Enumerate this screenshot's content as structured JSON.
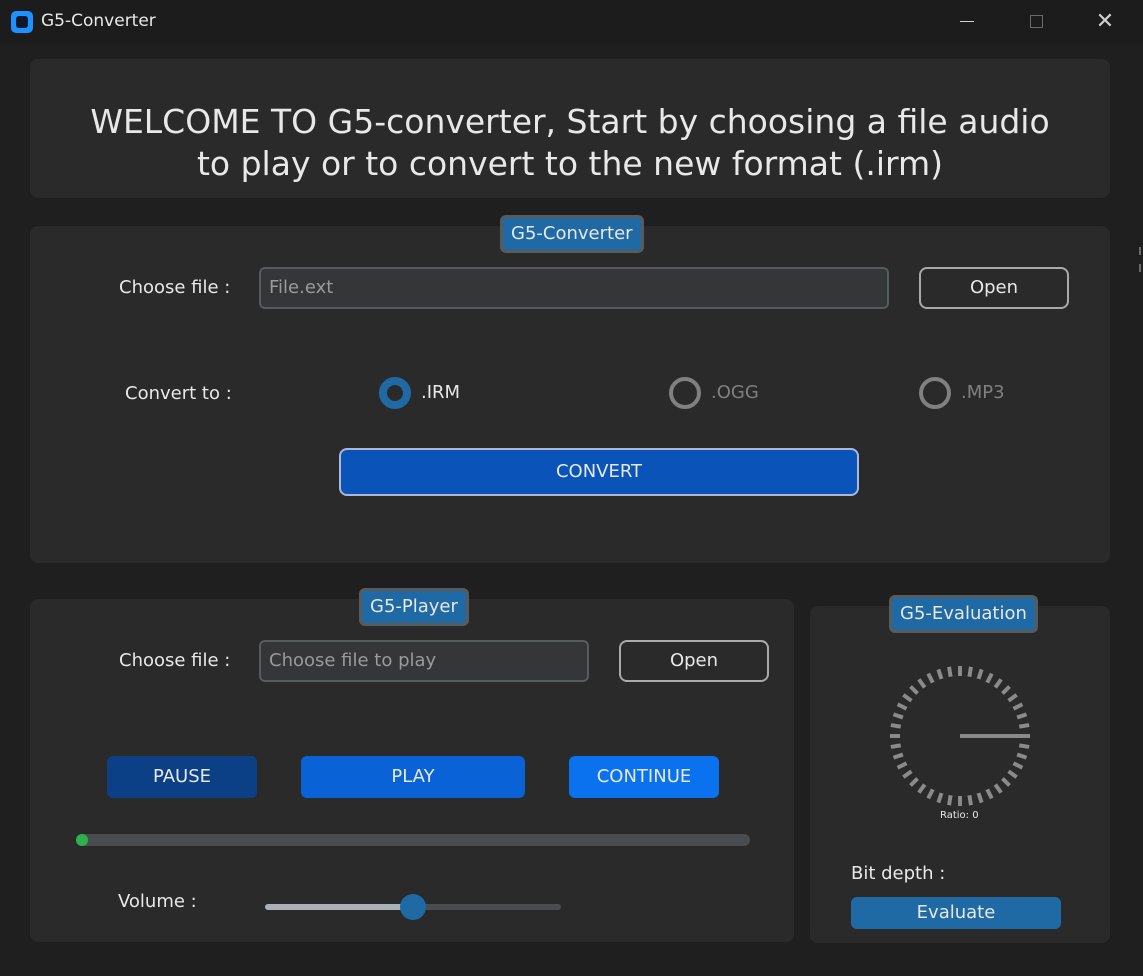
{
  "window": {
    "title": "G5-Converter",
    "app_icon": "app-logo-icon",
    "controls": {
      "minimize_icon": "minimize-icon",
      "maximize_icon": "maximize-icon",
      "close_icon": "close-icon",
      "close_glyph": "✕"
    }
  },
  "welcome": {
    "line1": "WELCOME TO G5-converter, Start by choosing a file audio",
    "line2": "to play or to convert to the new format (.irm)"
  },
  "converter": {
    "badge": "G5-Converter",
    "choose_label": "Choose file :",
    "file_placeholder": "File.ext",
    "open_label": "Open",
    "convert_to_label": "Convert to :",
    "formats": [
      {
        "label": ".IRM",
        "selected": true
      },
      {
        "label": ".OGG",
        "selected": false
      },
      {
        "label": ".MP3",
        "selected": false
      }
    ],
    "convert_label": "CONVERT"
  },
  "player": {
    "badge": "G5-Player",
    "choose_label": "Choose file :",
    "file_placeholder": "Choose file to play",
    "open_label": "Open",
    "pause_label": "PAUSE",
    "play_label": "PLAY",
    "continue_label": "CONTINUE",
    "progress": 0,
    "volume_label": "Volume :",
    "volume": 0.5
  },
  "evaluation": {
    "badge": "G5-Evaluation",
    "ratio_text": "Ratio: 0",
    "bit_depth_label": "Bit depth :",
    "evaluate_label": "Evaluate"
  },
  "colors": {
    "accent": "#1f6aa5",
    "convert_button": "#0a53b8",
    "pause_button": "#0b3f86",
    "play_button": "#0a63d6",
    "continue_button": "#0a72ee",
    "progress_fill": "#2bb24c"
  }
}
